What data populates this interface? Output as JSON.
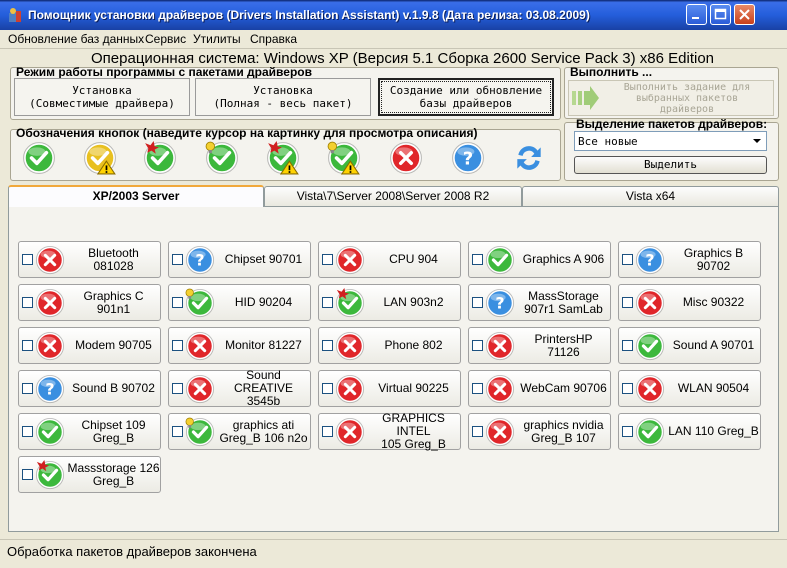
{
  "window": {
    "title": "Помощник установки драйверов (Drivers Installation Assistant) v.1.9.8 (Дата релиза: 03.08.2009)",
    "app_icon": "app-icon"
  },
  "menu": {
    "items": [
      "Обновление баз данных",
      "Сервис",
      "Утилиты",
      "Справка"
    ]
  },
  "os_info": "Операционная система: Windows XP  (Версия 5.1 Сборка 2600 Service Pack 3) x86 Edition",
  "mode_group": {
    "title": "Режим работы программы с пакетами драйверов",
    "buttons": [
      {
        "line1": "Установка",
        "line2": "(Совместимые драйвера)"
      },
      {
        "line1": "Установка",
        "line2": "(Полная - весь пакет)"
      },
      {
        "line1": "Создание или обновление",
        "line2": "базы драйверов"
      }
    ],
    "active_index": 2
  },
  "legend_group": {
    "title": "Обозначения кнопок (наведите курсор на картинку для просмотра описания)",
    "icons": [
      "check-icon",
      "warning-check-icon",
      "new-check-icon",
      "bulb-check-icon",
      "new-warning-check-icon",
      "bulb-warning-check-icon",
      "error-icon",
      "question-icon",
      "refresh-icon"
    ]
  },
  "run_group": {
    "title": "Выполнить ...",
    "button": {
      "line1": "Выполнить задание для",
      "line2": "выбранных пакетов",
      "line3": "драйверов"
    }
  },
  "select_group": {
    "title": "Выделение пакетов драйверов:",
    "selected": "Все новые",
    "button": "Выделить"
  },
  "tabs": [
    {
      "label": "XP/2003 Server"
    },
    {
      "label": "Vista\\7\\Server 2008\\Server 2008 R2"
    },
    {
      "label": "Vista x64"
    }
  ],
  "drivers": [
    {
      "label1": "Bluetooth 081028",
      "label2": "",
      "icon": "error-icon"
    },
    {
      "label1": "Chipset 90701",
      "label2": "",
      "icon": "question-icon"
    },
    {
      "label1": "CPU 904",
      "label2": "",
      "icon": "error-icon"
    },
    {
      "label1": "Graphics A 906",
      "label2": "",
      "icon": "check-icon"
    },
    {
      "label1": "Graphics B 90702",
      "label2": "",
      "icon": "question-icon"
    },
    {
      "label1": "Graphics C 901n1",
      "label2": "",
      "icon": "error-icon"
    },
    {
      "label1": "HID 90204",
      "label2": "",
      "icon": "bulb-check-icon"
    },
    {
      "label1": "LAN 903n2",
      "label2": "",
      "icon": "new-check-icon"
    },
    {
      "label1": "MassStorage",
      "label2": "907r1 SamLab",
      "icon": "question-icon"
    },
    {
      "label1": "Misc 90322",
      "label2": "",
      "icon": "error-icon"
    },
    {
      "label1": "Modem 90705",
      "label2": "",
      "icon": "error-icon"
    },
    {
      "label1": "Monitor 81227",
      "label2": "",
      "icon": "error-icon"
    },
    {
      "label1": "Phone 802",
      "label2": "",
      "icon": "error-icon"
    },
    {
      "label1": "PrintersHP 71126",
      "label2": "",
      "icon": "error-icon"
    },
    {
      "label1": "Sound A 90701",
      "label2": "",
      "icon": "check-icon"
    },
    {
      "label1": "Sound B 90702",
      "label2": "",
      "icon": "question-icon"
    },
    {
      "label1": "Sound CREATIVE",
      "label2": "3545b",
      "icon": "error-icon"
    },
    {
      "label1": "Virtual 90225",
      "label2": "",
      "icon": "error-icon"
    },
    {
      "label1": "WebCam 90706",
      "label2": "",
      "icon": "error-icon"
    },
    {
      "label1": "WLAN 90504",
      "label2": "",
      "icon": "error-icon"
    },
    {
      "label1": "Chipset 109",
      "label2": "Greg_B",
      "icon": "check-icon"
    },
    {
      "label1": "graphics ati",
      "label2": "Greg_B 106 n2o",
      "icon": "bulb-check-icon"
    },
    {
      "label1": "GRAPHICS INTEL",
      "label2": "105 Greg_B",
      "icon": "error-icon"
    },
    {
      "label1": "graphics nvidia",
      "label2": "Greg_B 107",
      "icon": "error-icon"
    },
    {
      "label1": "LAN 110 Greg_B",
      "label2": "",
      "icon": "check-icon"
    },
    {
      "label1": "Massstorage 126",
      "label2": "Greg_B",
      "icon": "new-check-icon"
    }
  ],
  "status": "Обработка пакетов драйверов закончена",
  "colors": {
    "ok": "#3cb83c",
    "error": "#e0262a",
    "question": "#3a8fe0",
    "warning": "#e8c020",
    "accent_tab": "#f1a83a"
  }
}
